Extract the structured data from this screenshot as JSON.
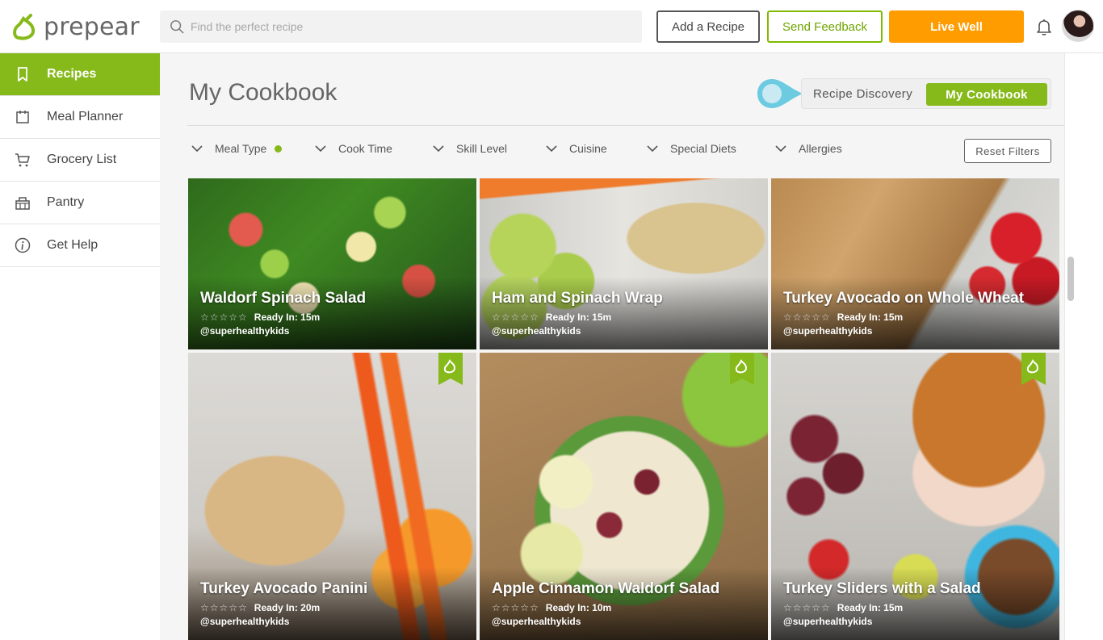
{
  "header": {
    "brand": "prepear",
    "search_placeholder": "Find the perfect recipe",
    "add_recipe": "Add a Recipe",
    "send_feedback": "Send Feedback",
    "live_well": "Live Well"
  },
  "sidebar": {
    "items": [
      {
        "label": "Recipes",
        "icon": "bookmark-icon",
        "active": true
      },
      {
        "label": "Meal Planner",
        "icon": "calendar-icon"
      },
      {
        "label": "Grocery List",
        "icon": "cart-icon"
      },
      {
        "label": "Pantry",
        "icon": "basket-icon"
      },
      {
        "label": "Get Help",
        "icon": "info-icon"
      }
    ]
  },
  "main": {
    "title": "My Cookbook",
    "toggle": {
      "discovery": "Recipe Discovery",
      "cookbook": "My Cookbook"
    },
    "filters": [
      "Meal Type",
      "Cook Time",
      "Skill Level",
      "Cuisine",
      "Special Diets",
      "Allergies"
    ],
    "reset": "Reset Filters"
  },
  "colors": {
    "brand_green": "#86b91a",
    "accent_orange": "#ff9c00",
    "pointer_blue": "#6ccbe0"
  },
  "recipes": [
    {
      "title": "Waldorf Spinach Salad",
      "ready": "Ready In: 15m",
      "author": "@superhealthykids"
    },
    {
      "title": "Ham and Spinach Wrap",
      "ready": "Ready In: 15m",
      "author": "@superhealthykids"
    },
    {
      "title": "Turkey Avocado on Whole Wheat",
      "ready": "Ready In: 15m",
      "author": "@superhealthykids"
    },
    {
      "title": "Turkey Avocado Panini",
      "ready": "Ready In: 20m",
      "author": "@superhealthykids"
    },
    {
      "title": "Apple Cinnamon Waldorf Salad",
      "ready": "Ready In: 10m",
      "author": "@superhealthykids"
    },
    {
      "title": "Turkey Sliders with a Salad",
      "ready": "Ready In: 15m",
      "author": "@superhealthykids"
    }
  ]
}
